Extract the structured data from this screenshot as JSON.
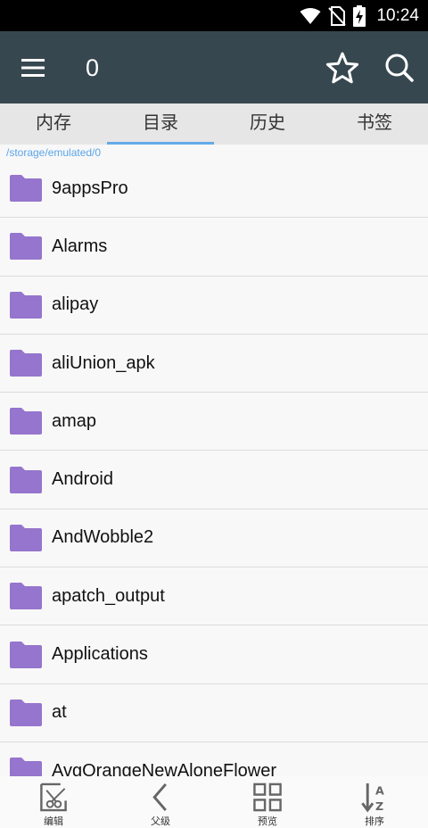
{
  "status_bar": {
    "time": "10:24",
    "icons": [
      "wifi-icon",
      "no-sim-icon",
      "battery-charging-icon"
    ]
  },
  "app_bar": {
    "title": "0",
    "icons": [
      "menu-icon",
      "star-icon",
      "search-icon"
    ]
  },
  "tabs": [
    {
      "label": "内存",
      "active": false
    },
    {
      "label": "目录",
      "active": true
    },
    {
      "label": "历史",
      "active": false
    },
    {
      "label": "书签",
      "active": false
    }
  ],
  "path": "/storage/emulated/0",
  "files": [
    {
      "name": "9appsPro",
      "icon": "folder-icon"
    },
    {
      "name": "Alarms",
      "icon": "folder-icon"
    },
    {
      "name": "alipay",
      "icon": "folder-icon"
    },
    {
      "name": "aliUnion_apk",
      "icon": "folder-icon"
    },
    {
      "name": "amap",
      "icon": "folder-icon"
    },
    {
      "name": "Android",
      "icon": "folder-icon"
    },
    {
      "name": "AndWobble2",
      "icon": "folder-icon"
    },
    {
      "name": "apatch_output",
      "icon": "folder-icon"
    },
    {
      "name": "Applications",
      "icon": "folder-icon"
    },
    {
      "name": "at",
      "icon": "folder-icon"
    },
    {
      "name": "AvgOrangeNewAloneFlower",
      "icon": "folder-icon"
    }
  ],
  "bottom_bar": [
    {
      "label": "编辑",
      "icon": "edit-icon"
    },
    {
      "label": "父级",
      "icon": "chevron-left-icon"
    },
    {
      "label": "预览",
      "icon": "grid-icon"
    },
    {
      "label": "排序",
      "icon": "sort-az-icon"
    }
  ],
  "colors": {
    "app_bar": "#37474f",
    "tab_indicator": "#64a9e8",
    "folder": "#9575cd",
    "path_text": "#5aa5e8"
  }
}
